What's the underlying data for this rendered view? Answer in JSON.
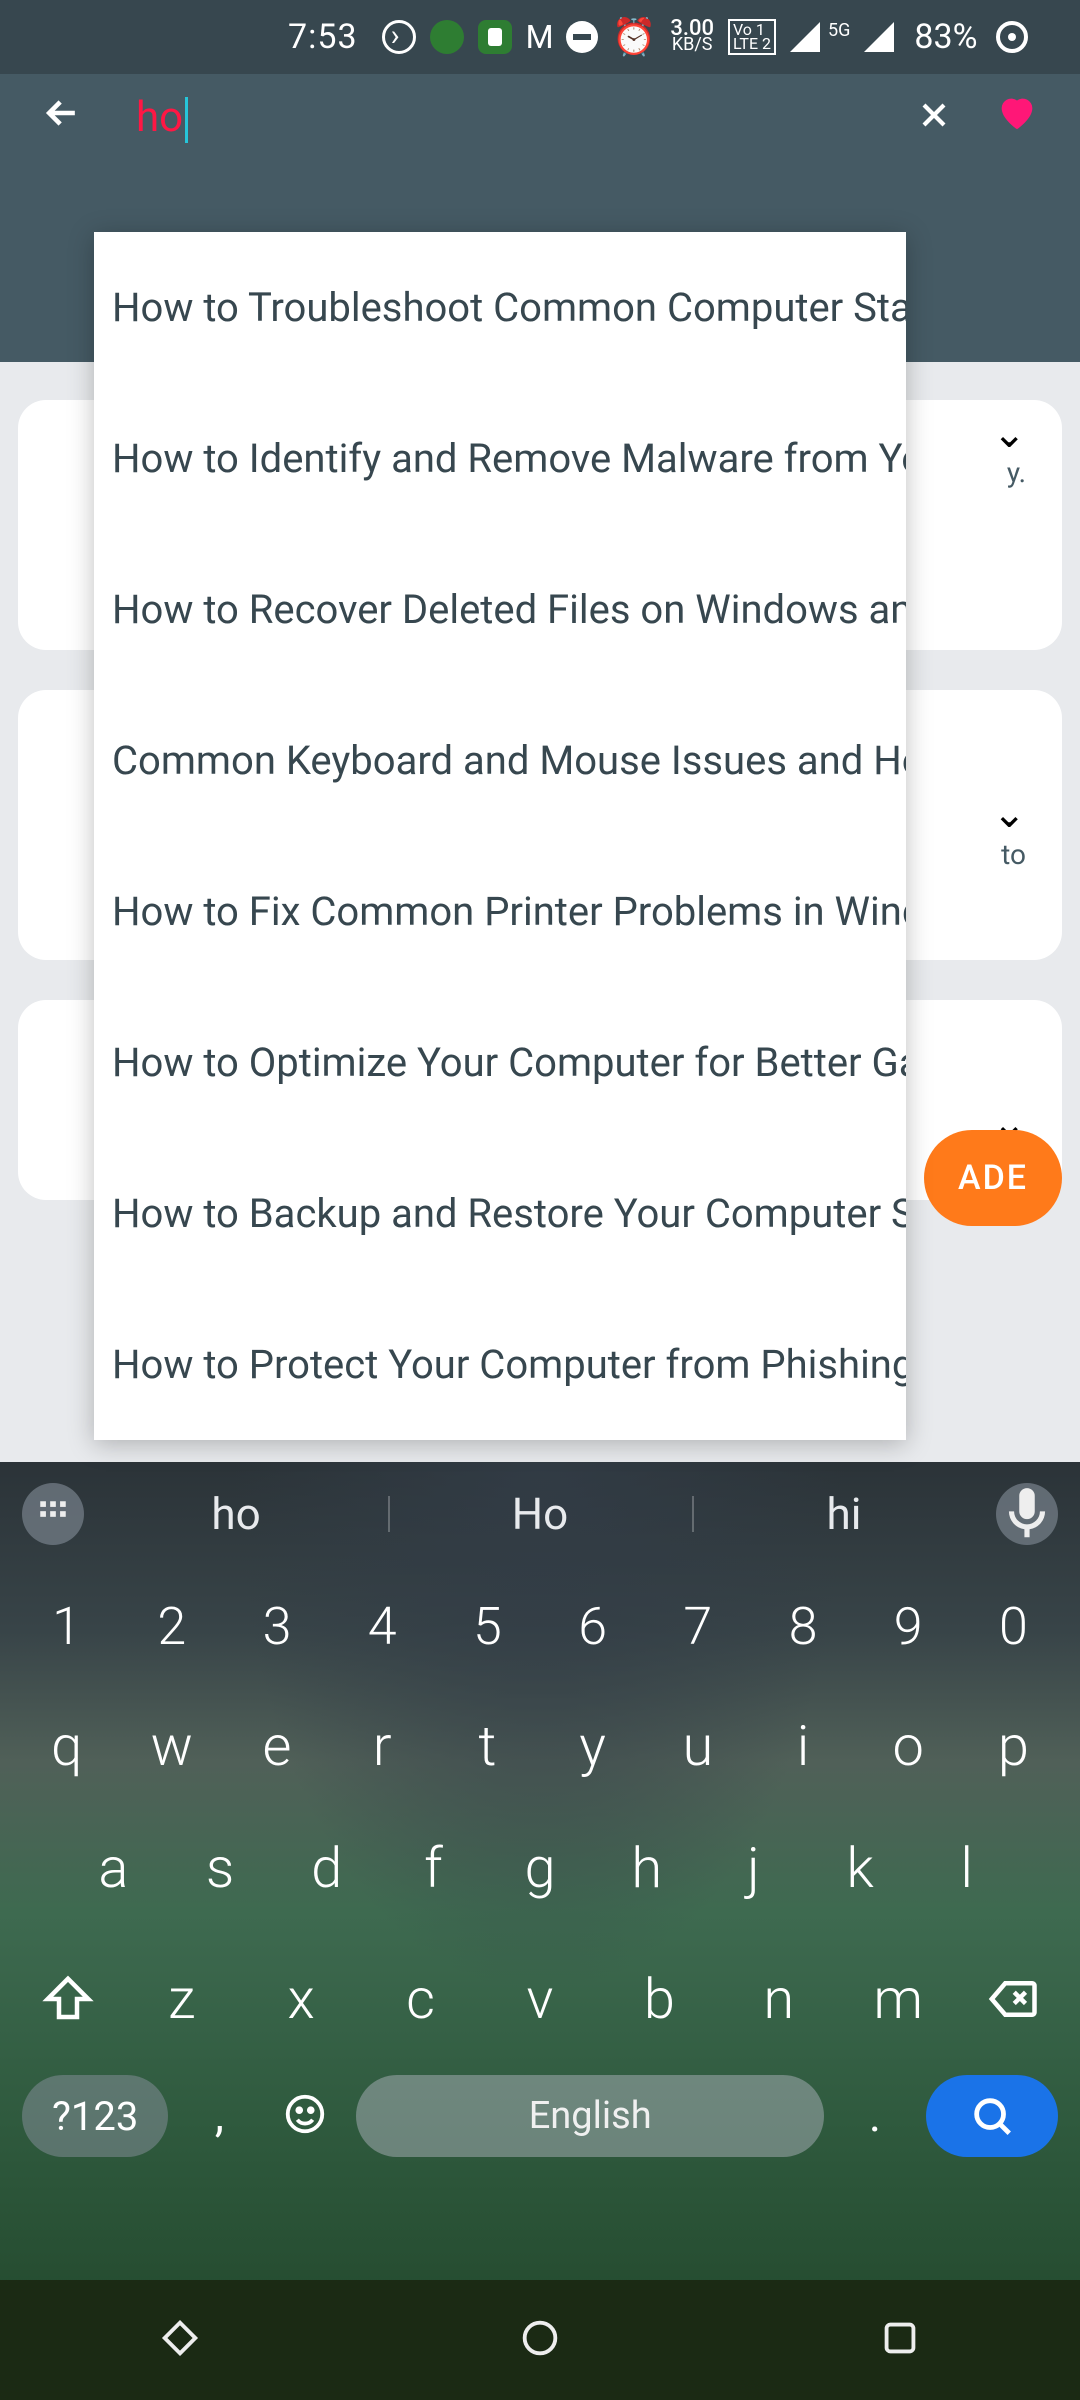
{
  "status": {
    "time": "7:53",
    "data_rate_top": "3.00",
    "data_rate_unit": "KB/S",
    "volte": "Vo 1\nLTE 2",
    "network_badge": "5G",
    "battery_pct": "83%"
  },
  "search": {
    "query": "ho"
  },
  "suggestions": [
    "How to Troubleshoot Common Computer Startup I..",
    "How to Identify and Remove Malware from Your C..",
    "How to Recover Deleted Files on Windows and Mac",
    "Common Keyboard and Mouse Issues and How to..",
    "How to Fix Common Printer Problems in Windows..",
    "How to Optimize Your Computer for Better Gaming..",
    "How to Backup and Restore Your Computer Syste..",
    "How to Protect Your Computer from Phishing and.."
  ],
  "background": {
    "card1_peek": "y.",
    "card2_peek": "to",
    "upgrade_fragment": "ADE"
  },
  "keyboard": {
    "predictions": [
      "ho",
      "Ho",
      "hi"
    ],
    "row_numbers": [
      "1",
      "2",
      "3",
      "4",
      "5",
      "6",
      "7",
      "8",
      "9",
      "0"
    ],
    "row_qwerty": [
      "q",
      "w",
      "e",
      "r",
      "t",
      "y",
      "u",
      "i",
      "o",
      "p"
    ],
    "row_asdf": [
      "a",
      "s",
      "d",
      "f",
      "g",
      "h",
      "j",
      "k",
      "l"
    ],
    "row_zxcv": [
      "z",
      "x",
      "c",
      "v",
      "b",
      "n",
      "m"
    ],
    "mode_key": "?123",
    "comma": ",",
    "space_label": "English",
    "period": "."
  }
}
